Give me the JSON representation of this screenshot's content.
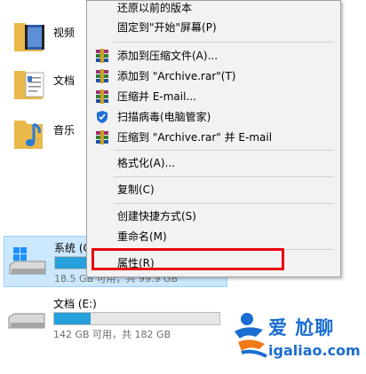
{
  "folders": [
    {
      "label": "视频",
      "icon": "video-folder-icon"
    },
    {
      "label": "文档",
      "icon": "document-folder-icon"
    },
    {
      "label": "音乐",
      "icon": "music-folder-icon"
    }
  ],
  "drives": [
    {
      "name": "系统 (C",
      "free_text": "18.5 GB 可用，共 99.9 GB",
      "used_fraction": 0.81,
      "selected": true
    },
    {
      "name": "文档 (E:)",
      "free_text": "142 GB 可用，共 182 GB",
      "used_fraction": 0.22,
      "selected": false
    }
  ],
  "context_menu": {
    "items": [
      {
        "label": "还原以前的版本",
        "icon": ""
      },
      {
        "label": "固定到\"开始\"屏幕(P)",
        "icon": ""
      },
      {
        "label": "添加到压缩文件(A)...",
        "icon": "winrar-icon"
      },
      {
        "label": "添加到 \"Archive.rar\"(T)",
        "icon": "winrar-icon"
      },
      {
        "label": "压缩并 E-mail...",
        "icon": "winrar-icon"
      },
      {
        "label": "扫描病毒(电脑管家)",
        "icon": "shield-icon"
      },
      {
        "label": "压缩到 \"Archive.rar\" 并 E-mail",
        "icon": "winrar-icon"
      },
      {
        "label": "格式化(A)...",
        "icon": ""
      },
      {
        "label": "复制(C)",
        "icon": ""
      },
      {
        "label": "创建快捷方式(S)",
        "icon": ""
      },
      {
        "label": "重命名(M)",
        "icon": ""
      },
      {
        "label": "属性(R)",
        "icon": ""
      }
    ]
  },
  "highlight_color": "#e8000e",
  "watermark": {
    "title": "爱 尬聊",
    "url": "igaliao.com"
  }
}
